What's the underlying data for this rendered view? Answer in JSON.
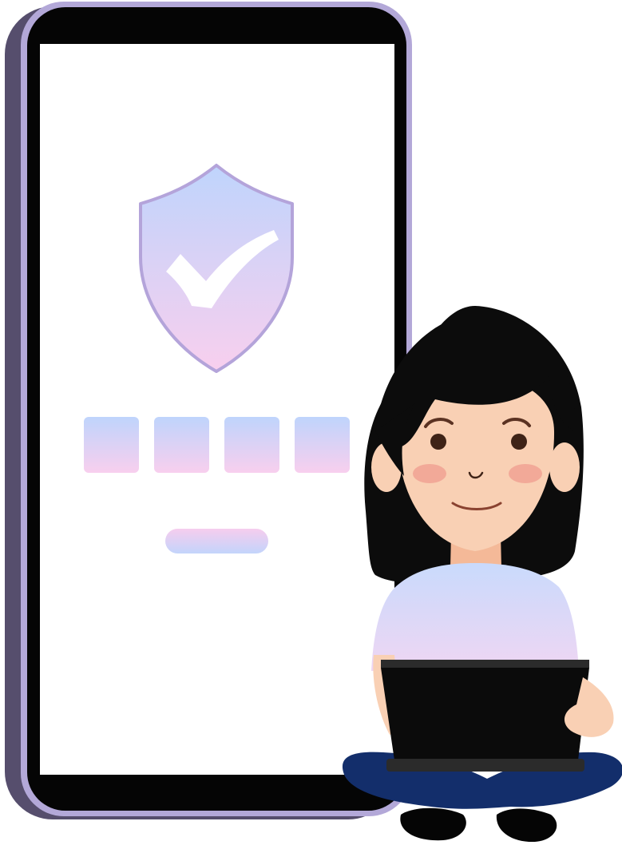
{
  "illustration": {
    "subject": "phone-verification-with-person",
    "phone": {
      "screen": {
        "shield_icon": "shield-check-icon",
        "code_boxes": [
          {
            "value": ""
          },
          {
            "value": ""
          },
          {
            "value": ""
          },
          {
            "value": ""
          }
        ],
        "confirm_button_label": ""
      }
    },
    "person": {
      "holding": "laptop-icon"
    }
  },
  "colors": {
    "phone_outline": "#b3a8d8",
    "phone_shadow": "#564e6d",
    "phone_body": "#050505",
    "screen_bg": "#ffffff",
    "gradient_top": "#bfd4fc",
    "gradient_bottom": "#f8cfee",
    "hair": "#0c0c0c",
    "skin": "#f9d0b4",
    "cheeks": "#f2a998",
    "shirt": "#ccdcfb",
    "pants": "#132e6b",
    "laptop": "#0b0b0b",
    "laptop_edge": "#2b2b2b"
  }
}
